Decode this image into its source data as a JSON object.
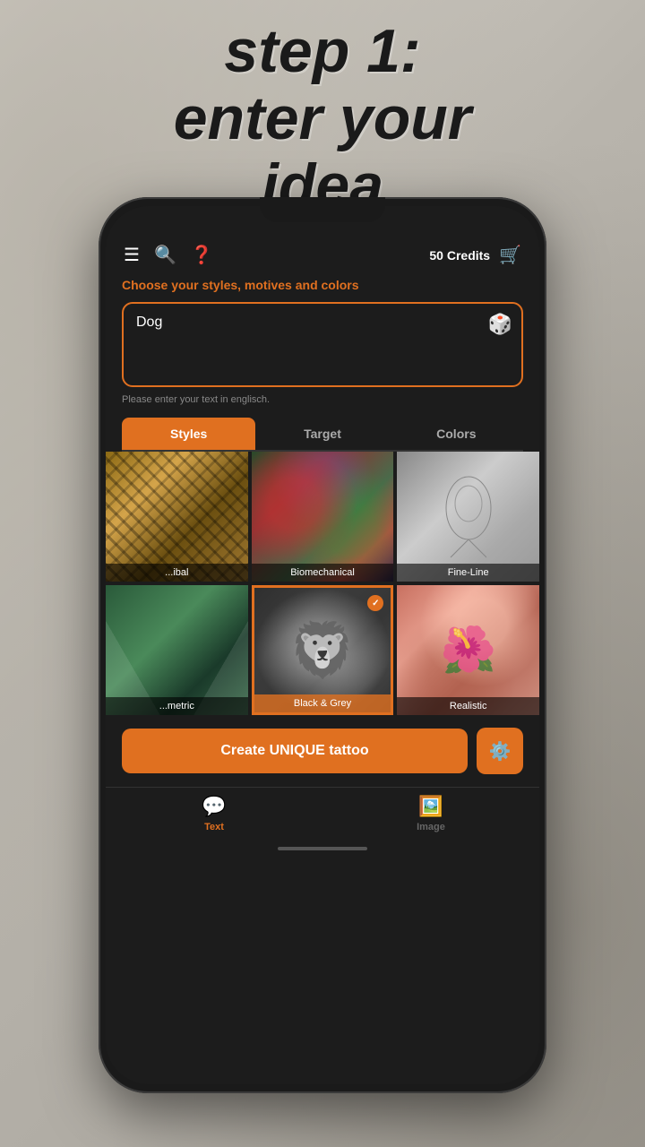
{
  "page": {
    "background_headline": "step 1:\nenter your\nidea"
  },
  "header": {
    "credits_label": "50 Credits"
  },
  "content": {
    "choose_text": "Choose your styles, motives and colors",
    "input_value": "Dog",
    "input_placeholder": "Dog",
    "hint_text": "Please enter your text in englisch."
  },
  "tabs": [
    {
      "label": "Styles",
      "active": true
    },
    {
      "label": "Target",
      "active": false
    },
    {
      "label": "Colors",
      "active": false
    }
  ],
  "styles": [
    {
      "id": "tribal",
      "label": "...ibal",
      "selected": false,
      "partial": true
    },
    {
      "id": "biomechanical",
      "label": "Biomechanical",
      "selected": false,
      "partial": false
    },
    {
      "id": "fine-line",
      "label": "Fine-Line",
      "selected": false,
      "partial": false
    },
    {
      "id": "geometric",
      "label": "...metric",
      "selected": false,
      "partial": true
    },
    {
      "id": "black-grey",
      "label": "Black & Grey",
      "selected": true,
      "partial": false
    },
    {
      "id": "realistic",
      "label": "Realistic",
      "selected": false,
      "partial": false
    }
  ],
  "cta": {
    "button_label": "Create UNIQUE tattoo"
  },
  "bottom_nav": [
    {
      "label": "Text",
      "icon": "💬",
      "active": true
    },
    {
      "label": "Image",
      "icon": "🖼️",
      "active": false
    }
  ]
}
